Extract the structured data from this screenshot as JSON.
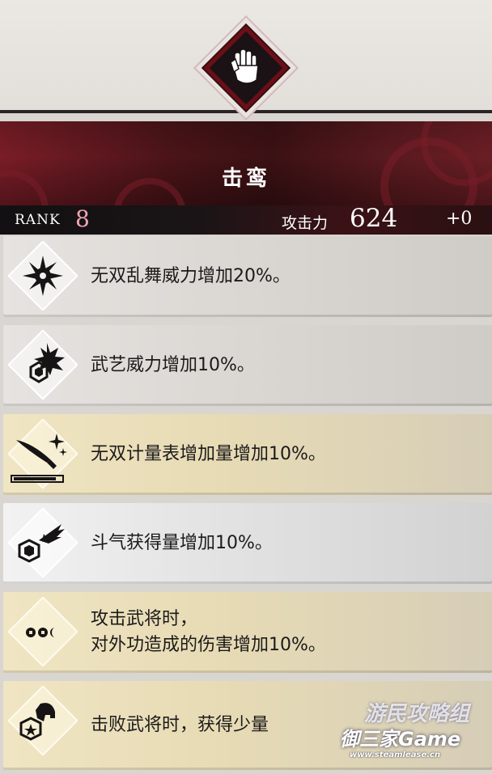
{
  "skill": {
    "name": "击鸾",
    "icon": "gauntlet-icon"
  },
  "stats": {
    "rank_label": "RANK",
    "rank_value": "8",
    "attack_label": "攻击力",
    "attack_value": "624",
    "attack_bonus": "+0"
  },
  "effects": [
    {
      "text": "无双乱舞威力增加20%。",
      "icon": "musou-burst-icon",
      "tier": "grey"
    },
    {
      "text": "武艺威力增加10%。",
      "icon": "martial-hexagon-burst-icon",
      "tier": "grey"
    },
    {
      "text": "无双计量表增加量增加10%。",
      "icon": "musou-gauge-sword-icon",
      "tier": "gold"
    },
    {
      "text": "斗气获得量增加10%。",
      "icon": "spirit-hexagon-wing-icon",
      "tier": "silver"
    },
    {
      "text_line1": "攻击武将时，",
      "text_line2": "对外功造成的伤害增加10%。",
      "icon": "triple-eye-icon",
      "tier": "gold"
    },
    {
      "text": "击败武将时，获得少量",
      "icon": "helmet-star-icon",
      "tier": "gold"
    }
  ],
  "watermark": {
    "line1": "游民攻略组",
    "line2": "御三家Game",
    "line3": "www.steamlease.cn"
  },
  "colors": {
    "banner": "#4a1418",
    "rank_accent": "#f1a5b2",
    "gold_tier": "#e7dbb5",
    "grey_tier": "#dad6d2"
  }
}
